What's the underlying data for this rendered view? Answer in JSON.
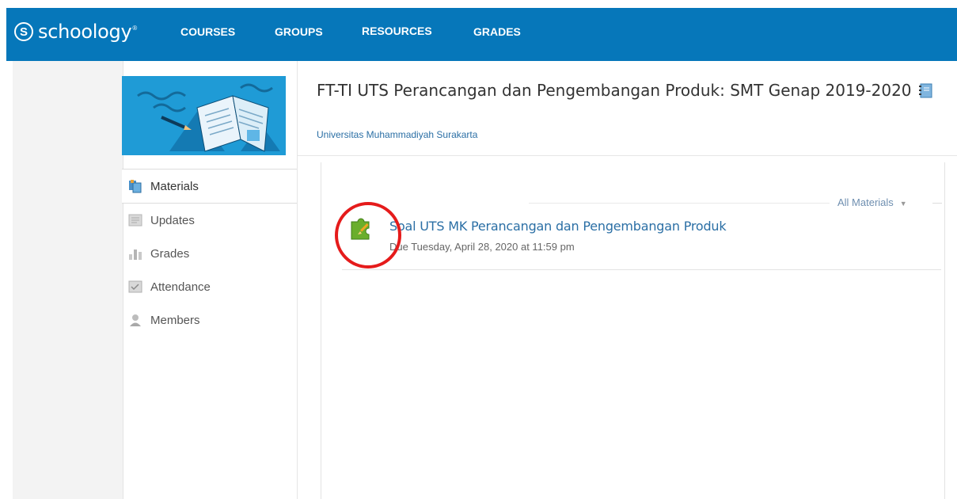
{
  "app": {
    "logo_text": "schoology",
    "logo_tm": "®",
    "brand_color": "#0677ba"
  },
  "nav": {
    "items": [
      {
        "label": "COURSES"
      },
      {
        "label": "GROUPS"
      },
      {
        "label": "RESOURCES"
      },
      {
        "label": "GRADES"
      }
    ]
  },
  "sidebar": {
    "items": [
      {
        "label": "Materials",
        "icon": "materials-icon",
        "active": true
      },
      {
        "label": "Updates",
        "icon": "updates-icon"
      },
      {
        "label": "Grades",
        "icon": "grades-icon"
      },
      {
        "label": "Attendance",
        "icon": "attendance-icon"
      },
      {
        "label": "Members",
        "icon": "members-icon"
      }
    ]
  },
  "course": {
    "title": "FT-TI UTS Perancangan dan Pengembangan Produk: SMT Genap 2019-2020",
    "organization": "Universitas Muhammadiyah Surakarta"
  },
  "materials": {
    "filter_label": "All Materials",
    "items": [
      {
        "title": "Soal UTS MK Perancangan dan Pengembangan Produk",
        "due": "Due Tuesday, April 28, 2020 at 11:59 pm",
        "icon": "assignment-puzzle-icon"
      }
    ]
  },
  "annotation": {
    "highlight_color": "#e51b1b"
  }
}
